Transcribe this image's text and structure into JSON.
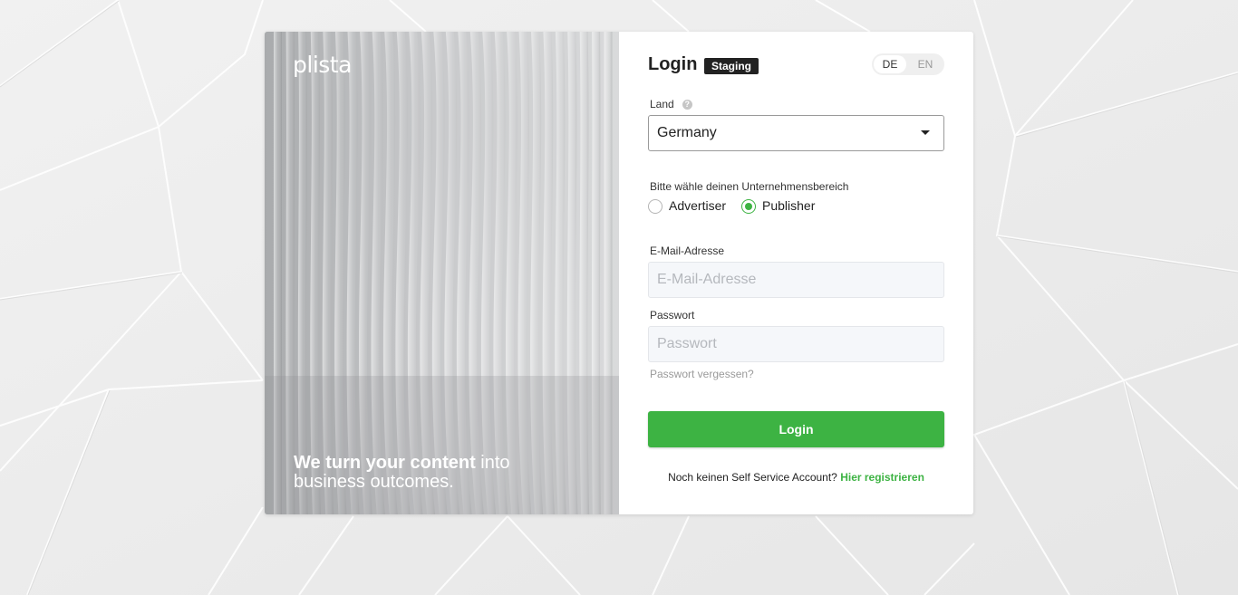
{
  "brand": {
    "logo_text": "plista",
    "tagline_bold": "We turn your content",
    "tagline_rest": " into business outcomes."
  },
  "header": {
    "title": "Login",
    "badge": "Staging",
    "lang_de": "DE",
    "lang_en": "EN"
  },
  "form": {
    "country_label": "Land",
    "country_value": "Germany",
    "business_label": "Bitte wähle deinen Unternehmensbereich",
    "radio_advertiser": "Advertiser",
    "radio_publisher": "Publisher",
    "radio_selected": "Publisher",
    "email_label": "E-Mail-Adresse",
    "email_placeholder": "E-Mail-Adresse",
    "password_label": "Passwort",
    "password_placeholder": "Passwort",
    "forgot_link": "Passwort vergessen?",
    "login_button": "Login",
    "register_prompt": "Noch keinen Self Service Account? ",
    "register_link": "Hier registrieren"
  },
  "colors": {
    "accent": "#3db343",
    "badge_bg": "#222222"
  },
  "icons": {
    "help": "question-circle-icon",
    "select_caret": "caret-down-icon"
  }
}
